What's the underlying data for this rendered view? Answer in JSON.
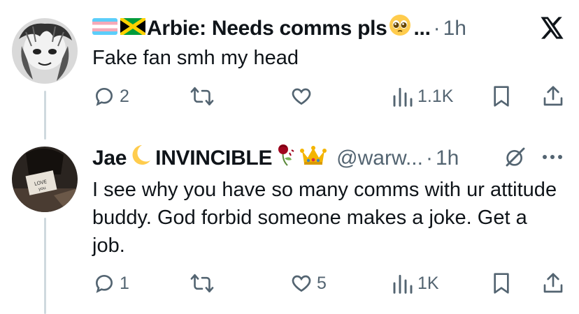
{
  "tweets": [
    {
      "display_name": "Arbie: Needs comms pls",
      "ellipsis": "...",
      "time": "1h",
      "text": "Fake fan smh my head",
      "actions": {
        "replies": "2",
        "reposts": "",
        "likes": "",
        "views": "1.1K"
      },
      "header_icon": "x-logo-icon"
    },
    {
      "display_name_prefix": "Jae",
      "display_name_suffix": "INVINCIBLE",
      "handle": "@warw...",
      "time": "1h",
      "text": "I see why you have so many comms with ur attitude buddy. God forbid someone makes a joke. Get a job.",
      "actions": {
        "replies": "1",
        "reposts": "",
        "likes": "5",
        "views": "1K"
      },
      "header_icons": [
        "grok-icon",
        "more-icon"
      ]
    }
  ],
  "colors": {
    "text": "#0f1419",
    "muted": "#536471",
    "thread_line": "#cfd9de"
  }
}
